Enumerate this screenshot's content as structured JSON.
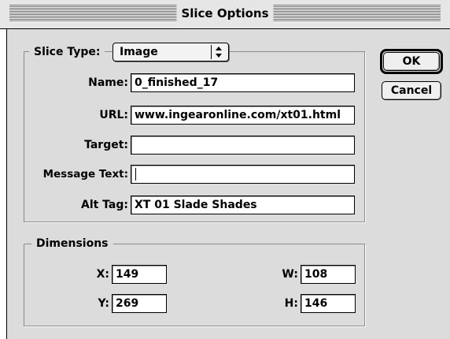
{
  "window": {
    "title": "Slice Options"
  },
  "slice_type": {
    "label": "Slice Type:",
    "selected": "Image"
  },
  "fields": {
    "name": {
      "label": "Name:",
      "value": "0_finished_17"
    },
    "url": {
      "label": "URL:",
      "value": "www.ingearonline.com/xt01.html"
    },
    "target": {
      "label": "Target:",
      "value": ""
    },
    "message_text": {
      "label": "Message Text:",
      "value": ""
    },
    "alt_tag": {
      "label": "Alt Tag:",
      "value": "XT 01 Slade Shades"
    }
  },
  "dimensions": {
    "legend": "Dimensions",
    "x": {
      "label": "X:",
      "value": "149"
    },
    "y": {
      "label": "Y:",
      "value": "269"
    },
    "w": {
      "label": "W:",
      "value": "108"
    },
    "h": {
      "label": "H:",
      "value": "146"
    }
  },
  "buttons": {
    "ok": "OK",
    "cancel": "Cancel"
  },
  "icons": {
    "popup_arrows": "up-down-arrows-icon"
  }
}
